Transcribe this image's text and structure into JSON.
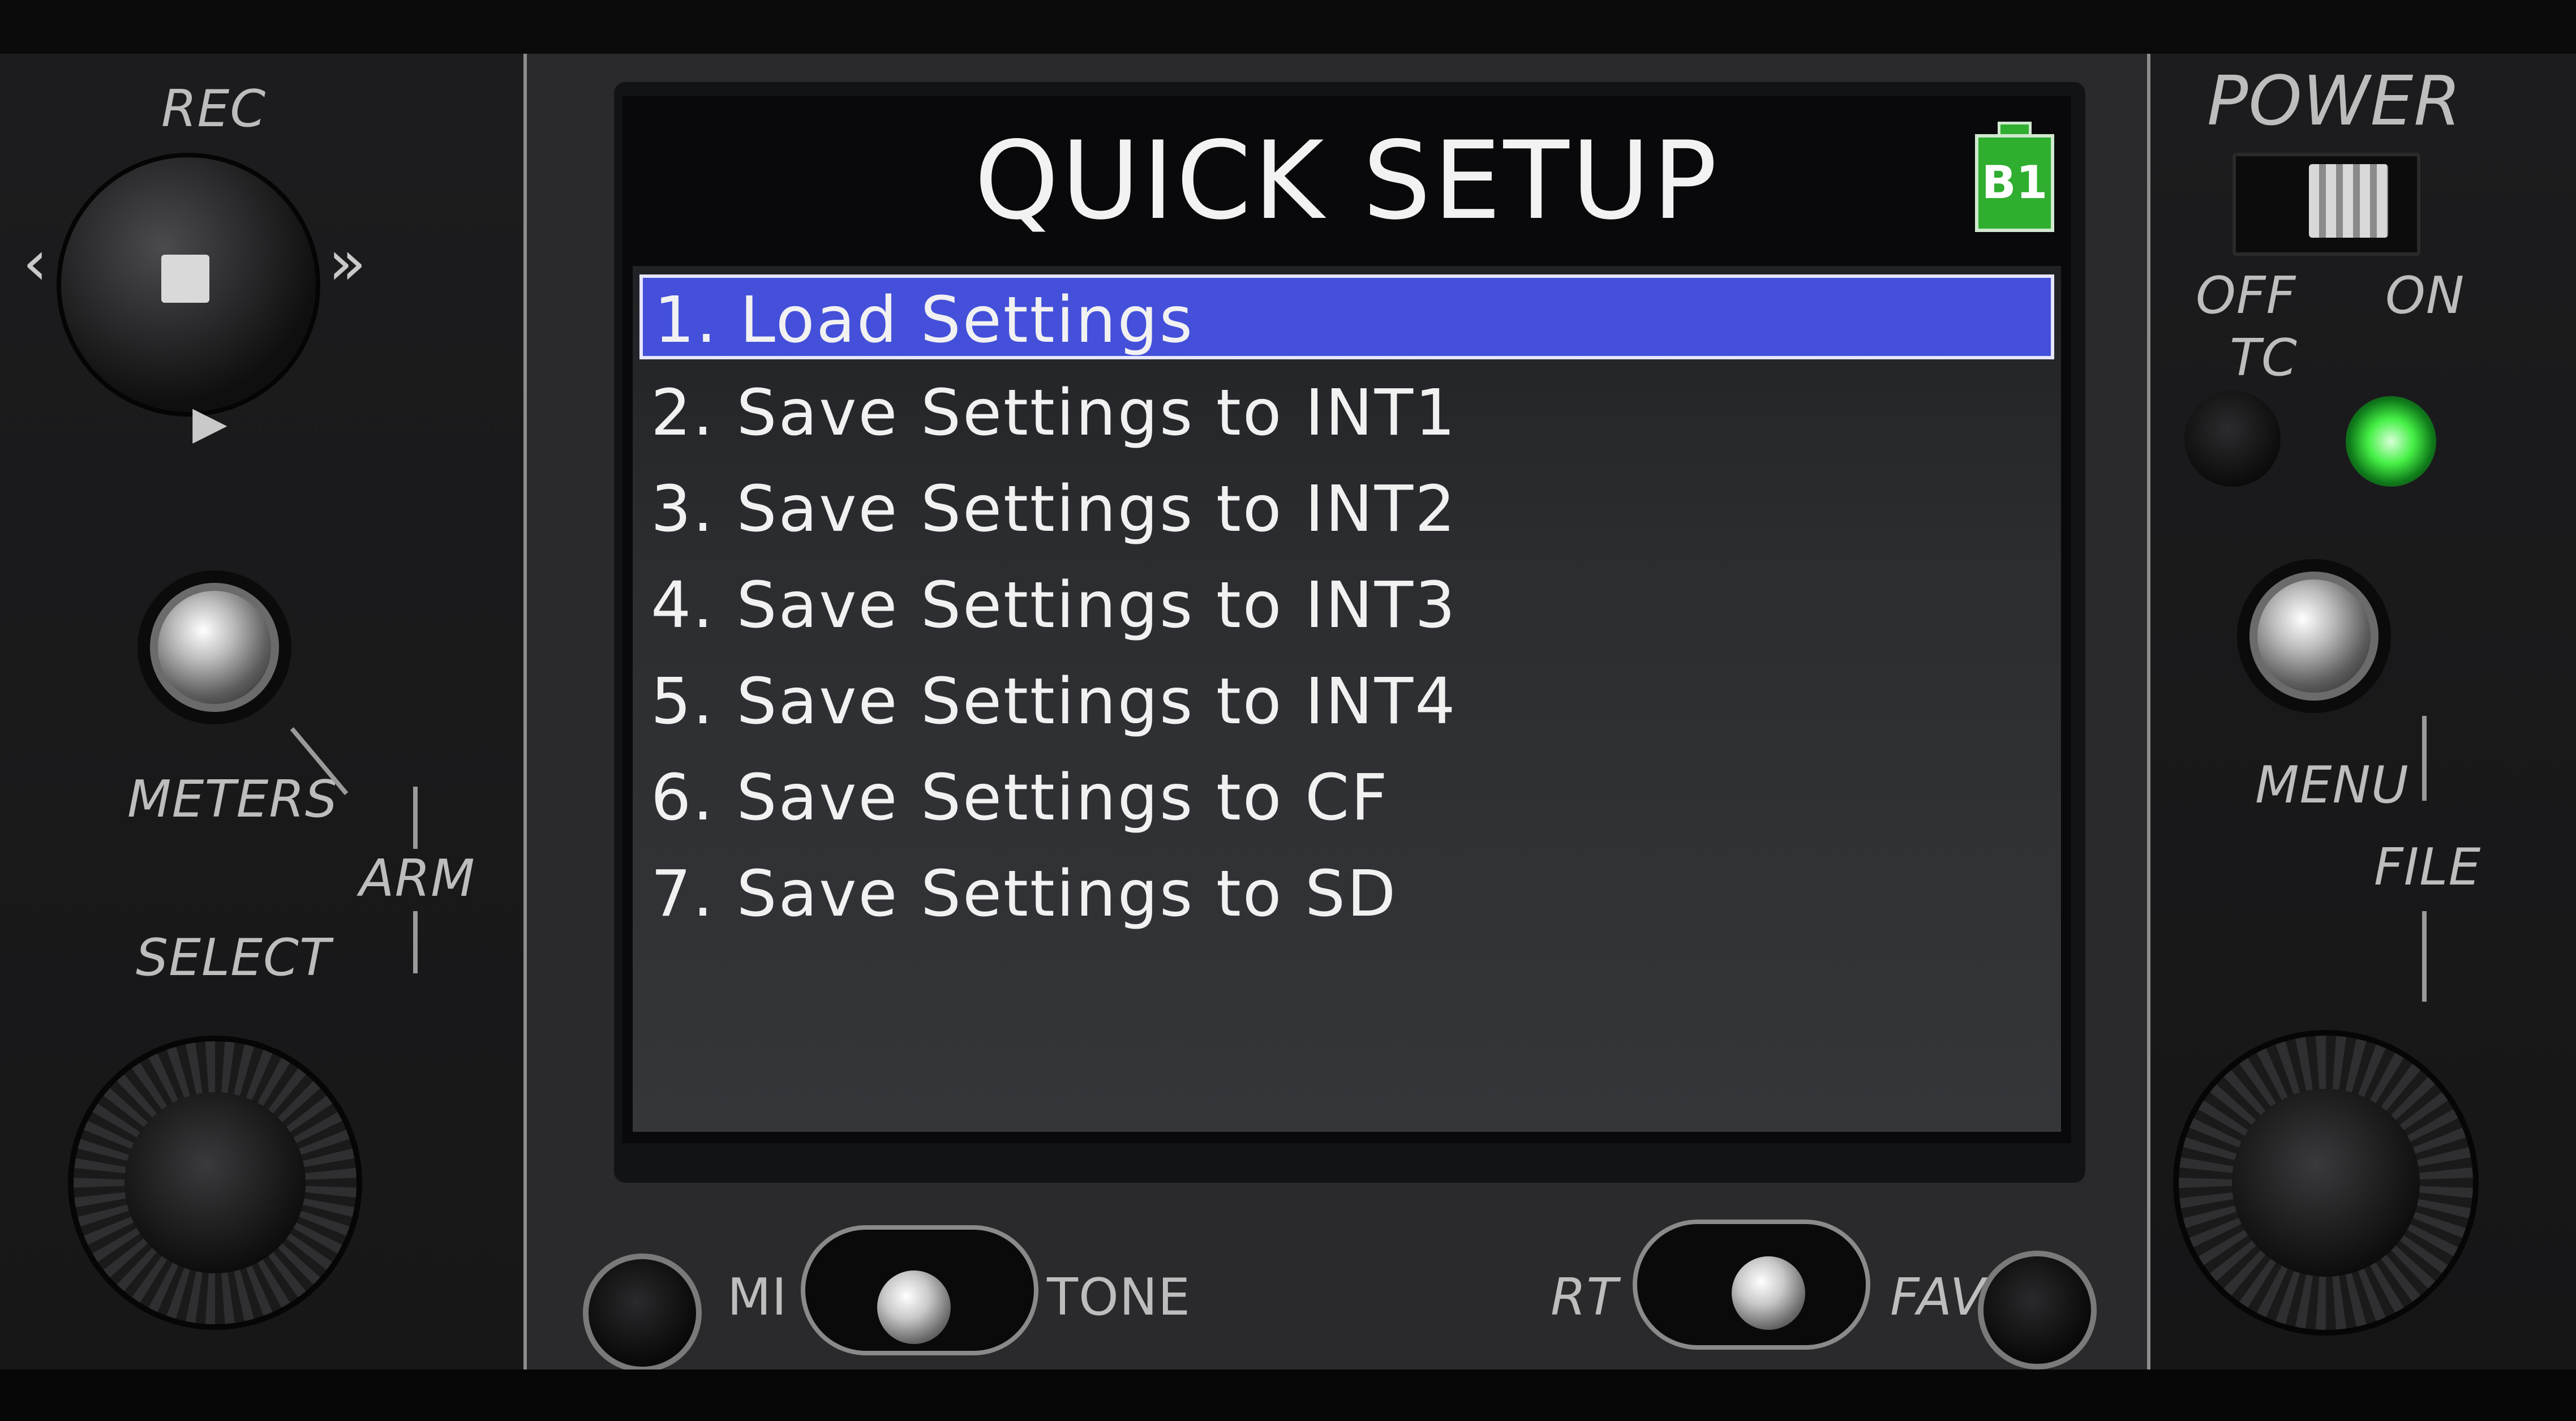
{
  "screen": {
    "title": "QUICK SETUP",
    "battery_label": "B1",
    "menu_items": [
      {
        "label": "1. Load Settings",
        "selected": true
      },
      {
        "label": "2. Save Settings to INT1",
        "selected": false
      },
      {
        "label": "3. Save Settings to INT2",
        "selected": false
      },
      {
        "label": "4. Save Settings to INT3",
        "selected": false
      },
      {
        "label": "5. Save Settings to INT4",
        "selected": false
      },
      {
        "label": "6. Save Settings to CF",
        "selected": false
      },
      {
        "label": "7. Save Settings to SD",
        "selected": false
      }
    ],
    "highlight_color": "#4450d9"
  },
  "left_controls": {
    "rec_label": "REC",
    "meters_label": "METERS",
    "arm_label": "ARM",
    "select_label": "SELECT"
  },
  "right_controls": {
    "power_label": "POWER",
    "off_label": "OFF",
    "on_label": "ON",
    "tc_label": "TC",
    "menu_label": "MENU",
    "file_label": "FILE",
    "led_color": "#46f046"
  },
  "bottom_controls": {
    "mic_label": "MI",
    "tone_label": "TONE",
    "rtn_label": "RT",
    "fav_label": "FAV"
  }
}
